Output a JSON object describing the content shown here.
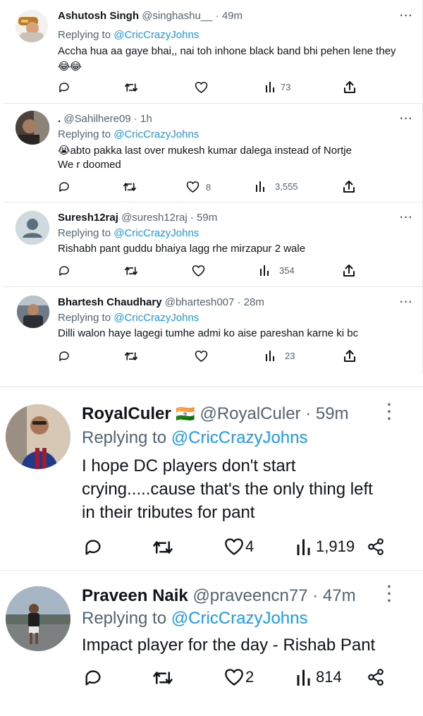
{
  "top_tweets": [
    {
      "name": "Ashutosh Singh",
      "handle": "@singhashu__",
      "time": "· 49m",
      "replying_prefix": "Replying to",
      "replying_to": "@CricCrazyJohns",
      "text_line1": "Accha hua aa gaye bhai,, nai toh inhone black band bhi pehen lene they",
      "text_line2": "😂😂",
      "reply_count": "",
      "retweet_count": "",
      "like_count": "",
      "views": "73"
    },
    {
      "name": ".",
      "handle": "@Sahilhere09",
      "time": "· 1h",
      "replying_prefix": "Replying to",
      "replying_to": "@CricCrazyJohns",
      "text_line1": "😭abto pakka last over mukesh kumar dalega instead of Nortje",
      "text_line2": "We r doomed",
      "reply_count": "",
      "retweet_count": "",
      "like_count": "8",
      "views": "3,555"
    },
    {
      "name": "Suresh12raj",
      "handle": "@suresh12raj",
      "time": "· 59m",
      "replying_prefix": "Replying to",
      "replying_to": "@CricCrazyJohns",
      "text_line1": "Rishabh pant guddu bhaiya lagg rhe mirzapur 2 wale",
      "text_line2": "",
      "reply_count": "",
      "retweet_count": "",
      "like_count": "",
      "views": "354"
    },
    {
      "name": "Bhartesh Chaudhary",
      "handle": "@bhartesh007",
      "time": "· 28m",
      "replying_prefix": "Replying to",
      "replying_to": "@CricCrazyJohns",
      "text_line1": "Dilli walon haye lagegi tumhe admi ko aise pareshan karne ki bc",
      "text_line2": "",
      "reply_count": "",
      "retweet_count": "",
      "like_count": "",
      "views": "23"
    }
  ],
  "bottom_tweets": [
    {
      "name": "RoyalCuler",
      "flag": "🇮🇳",
      "handle": "@RoyalCuler",
      "time": "· 59m",
      "replying_prefix": "Replying to",
      "replying_to": "@CricCrazyJohns",
      "text_line1": "I hope DC players don't start",
      "text_line2": "crying.....cause that's the only thing left",
      "text_line3": "in their tributes for pant",
      "like_count": "4",
      "views": "1,919"
    },
    {
      "name": "Praveen Naik",
      "handle": "@praveencn77",
      "time": "· 47m",
      "replying_prefix": "Replying to",
      "replying_to": "@CricCrazyJohns",
      "text_line1": "Impact player for the day - Rishab Pant",
      "like_count": "2",
      "views": "814"
    }
  ],
  "colors": {
    "text": "#0f1419",
    "secondary": "#536471",
    "link": "#1d9bf0",
    "divider": "#e4e8eb"
  },
  "icons": [
    "reply-icon",
    "retweet-icon",
    "like-icon",
    "views-icon",
    "share-icon",
    "more-icon"
  ]
}
